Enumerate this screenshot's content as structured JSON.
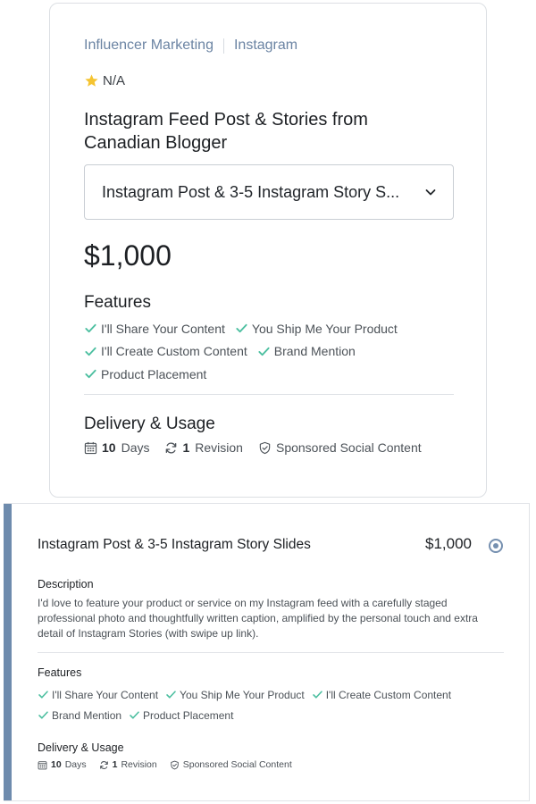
{
  "top_card": {
    "breadcrumb": [
      "Influencer Marketing",
      "Instagram"
    ],
    "rating": "N/A",
    "title": "Instagram Feed Post & Stories from Canadian Blogger",
    "package_select": "Instagram Post & 3-5 Instagram Story S...",
    "price": "$1,000",
    "features_heading": "Features",
    "features": [
      "I'll Share Your Content",
      "You Ship Me Your Product",
      "I'll Create Custom Content",
      "Brand Mention",
      "Product Placement"
    ],
    "delivery_heading": "Delivery & Usage",
    "delivery": {
      "days_value": "10",
      "days_label": "Days",
      "revision_value": "1",
      "revision_label": "Revision",
      "usage": "Sponsored Social Content"
    }
  },
  "option_card": {
    "title": "Instagram Post & 3-5 Instagram Story Slides",
    "price": "$1,000",
    "description_heading": "Description",
    "description": "I'd love to feature your product or service on my Instagram feed with a carefully staged professional photo and thoughtfully written caption, amplified by the personal touch and extra detail of Instagram Stories (with swipe up link).",
    "features_heading": "Features",
    "features": [
      "I'll Share Your Content",
      "You Ship Me Your Product",
      "I'll Create Custom Content",
      "Brand Mention",
      "Product Placement"
    ],
    "delivery_heading": "Delivery & Usage",
    "delivery": {
      "days_value": "10",
      "days_label": "Days",
      "revision_value": "1",
      "revision_label": "Revision",
      "usage": "Sponsored Social Content"
    }
  },
  "colors": {
    "accent": "#6e8bad",
    "check_green": "#4cbfa0",
    "star": "#f5c431",
    "link": "#6b84a3"
  },
  "icons": [
    "star-icon",
    "chevron-down-icon",
    "check-icon",
    "calendar-icon",
    "refresh-icon",
    "shield-icon",
    "radio-selected-icon"
  ]
}
